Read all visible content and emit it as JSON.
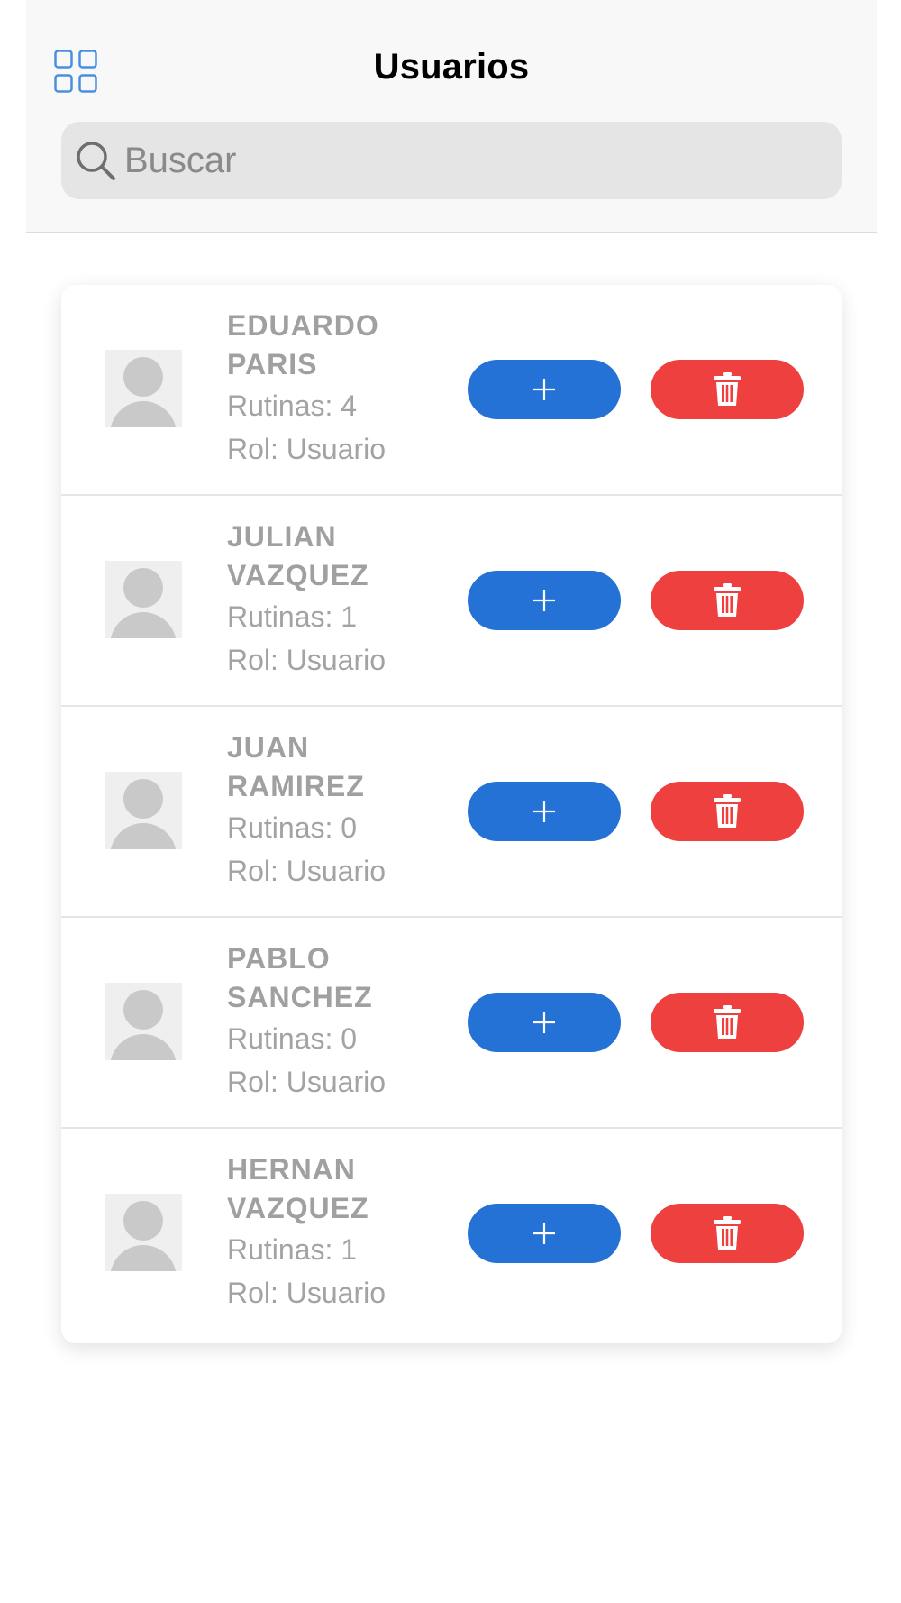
{
  "header": {
    "title": "Usuarios",
    "menu_icon": "grid-icon"
  },
  "search": {
    "placeholder": "Buscar",
    "value": "",
    "icon": "search-icon"
  },
  "colors": {
    "accent_blue": "#2472d6",
    "danger_red": "#ef4040",
    "text_gray": "#a0a0a0"
  },
  "users": [
    {
      "first": "EDUARDO",
      "last": "PARIS",
      "rutinas": "Rutinas: 4",
      "rol": "Rol: Usuario"
    },
    {
      "first": "JULIAN",
      "last": "VAZQUEZ",
      "rutinas": "Rutinas: 1",
      "rol": "Rol: Usuario"
    },
    {
      "first": "JUAN",
      "last": "RAMIREZ",
      "rutinas": "Rutinas: 0",
      "rol": "Rol: Usuario"
    },
    {
      "first": "PABLO",
      "last": "SANCHEZ",
      "rutinas": "Rutinas: 0",
      "rol": "Rol: Usuario"
    },
    {
      "first": "HERNAN",
      "last": "VAZQUEZ",
      "rutinas": "Rutinas: 1",
      "rol": "Rol: Usuario"
    }
  ],
  "row_actions": {
    "add_icon": "plus-icon",
    "delete_icon": "trash-icon"
  }
}
